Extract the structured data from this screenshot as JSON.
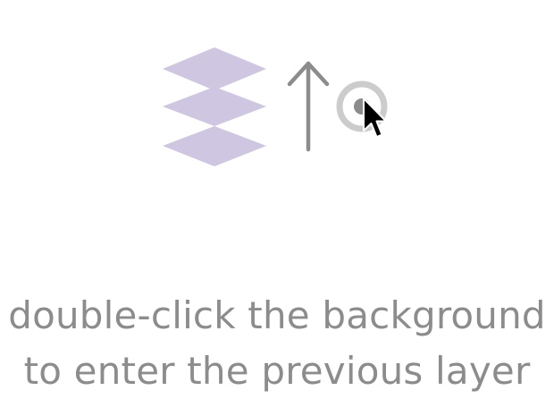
{
  "hint": {
    "line1": "double-click the background",
    "line2": "to enter the previous layer"
  },
  "icons": {
    "layers": "layers-icon",
    "arrow": "arrow-up-icon",
    "target": "target-icon",
    "cursor": "mouse-pointer-icon"
  },
  "colors": {
    "layers": "#cfc6e1",
    "arrow": "#8c8c8c",
    "target_ring": "#cccccc",
    "target_dot": "#8c8c8c",
    "text": "#8c8c8c"
  }
}
